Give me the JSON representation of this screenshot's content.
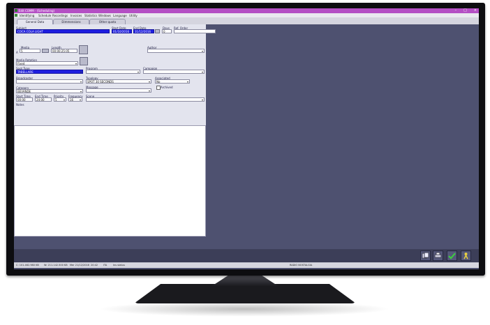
{
  "window": {
    "title": "Edit COMM - (Scheduling)",
    "controls": [
      "–",
      "□",
      "×"
    ]
  },
  "menu": [
    "Identifying",
    "Schedule",
    "Recordings",
    "Invoices",
    "Statistics",
    "Windows",
    "Language",
    "Utility"
  ],
  "tabs": [
    "General Data",
    "Dimmensions",
    "Other quota"
  ],
  "form": {
    "subject": {
      "label": "Subject",
      "value": "COCA COLA LIGHT"
    },
    "start_date": {
      "label": "Start Date",
      "value": "01/10/2016"
    },
    "end_date": {
      "label": "End Date",
      "value": "31/12/2016"
    },
    "days": {
      "label": "Days",
      "value": "0"
    },
    "ref_order": {
      "label": "Ref. Order",
      "value": ""
    },
    "media": {
      "label": "Media",
      "prefix": "A",
      "value": "5"
    },
    "length": {
      "label": "Length",
      "value": "00:00:25:05"
    },
    "author": {
      "label": "Author",
      "value": ""
    },
    "media_rotation": {
      "label": "Media Rotation",
      "value": "Fixed"
    },
    "spot_type": {
      "label": "Spot Type",
      "value": "TABELLARE"
    },
    "program": {
      "label": "Program",
      "value": ""
    },
    "campaign": {
      "label": "Campaign",
      "value": ""
    },
    "broadcaster": {
      "label": "Broadcaster",
      "value": ""
    },
    "typology": {
      "label": "Typology",
      "value": "SPOT 30 SECONDS"
    },
    "associated": {
      "label": "Associated",
      "value": "No"
    },
    "category": {
      "label": "Category",
      "value": "BEVANDE"
    },
    "message": {
      "label": "Message",
      "value": ""
    },
    "archived": {
      "label": "Archived"
    },
    "start_time": {
      "label": "Start Time",
      "value": "00:00"
    },
    "end_time": {
      "label": "End Time",
      "value": "24:00"
    },
    "priority": {
      "label": "Priority",
      "value": "5"
    },
    "frequency": {
      "label": "Frequency",
      "value": "16"
    },
    "scene": {
      "label": "Scene",
      "value": ""
    },
    "notes": {
      "label": "Notes",
      "value": ""
    }
  },
  "status": [
    "C: 101.462.980 KB",
    "W: 211.142.500 KB",
    "Mer 21/12/2016",
    "20:42",
    "ITA",
    "Ins status",
    "RADIO NOSTALGIA"
  ],
  "actions": [
    "copy-icon",
    "print-icon",
    "confirm-icon",
    "exit-icon"
  ],
  "colors": {
    "titlebar": "#b44fc4",
    "highlight": "#1f1fe0",
    "background": "#4e5170"
  }
}
